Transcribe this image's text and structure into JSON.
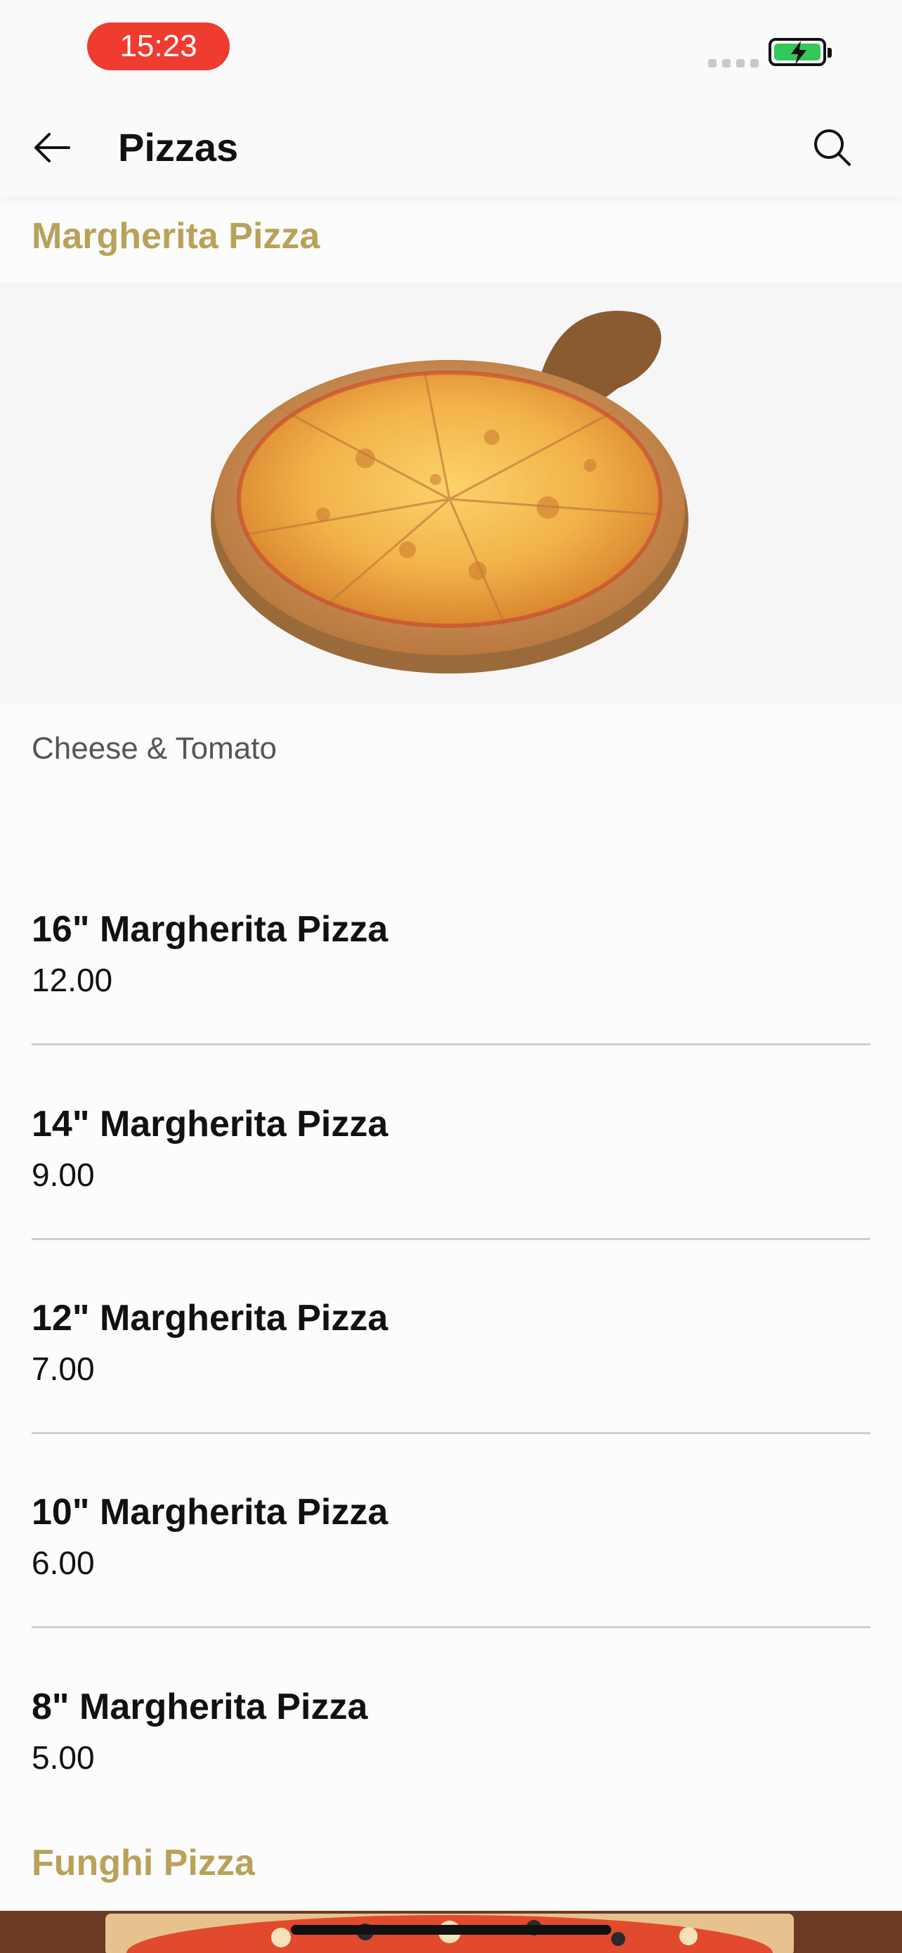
{
  "status": {
    "time": "15:23"
  },
  "header": {
    "title": "Pizzas"
  },
  "sections": [
    {
      "title": "Margherita Pizza",
      "description": "Cheese & Tomato",
      "items": [
        {
          "name": "16\" Margherita Pizza",
          "price": "12.00"
        },
        {
          "name": "14\" Margherita Pizza",
          "price": "9.00"
        },
        {
          "name": "12\" Margherita Pizza",
          "price": "7.00"
        },
        {
          "name": "10\" Margherita Pizza",
          "price": "6.00"
        },
        {
          "name": "8\" Margherita Pizza",
          "price": "5.00"
        }
      ]
    },
    {
      "title": "Funghi Pizza"
    }
  ],
  "colors": {
    "accent": "#b8a25a",
    "time_pill": "#ef3b30",
    "battery": "#34c759"
  },
  "icons": [
    "back-arrow-icon",
    "search-icon",
    "battery-charging-icon",
    "cellular-signal-icon"
  ]
}
